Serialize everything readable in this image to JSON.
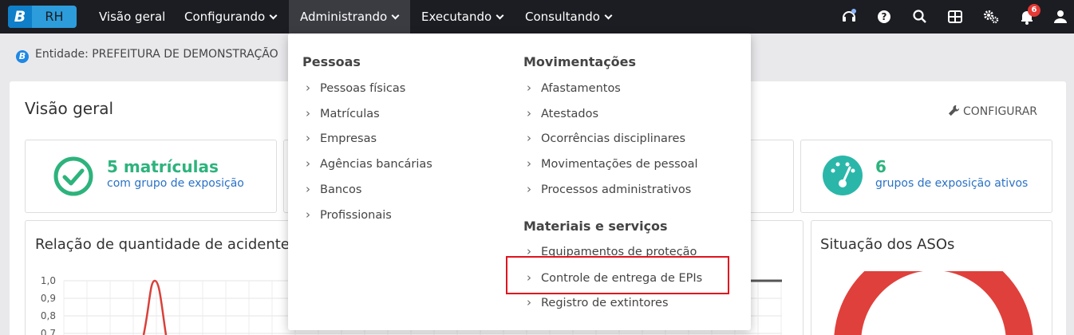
{
  "app": {
    "logo_letter": "B",
    "logo_text": "RH"
  },
  "nav": {
    "items": [
      {
        "label": "Visão geral"
      },
      {
        "label": "Configurando"
      },
      {
        "label": "Administrando"
      },
      {
        "label": "Executando"
      },
      {
        "label": "Consultando"
      }
    ],
    "notification_count": "6"
  },
  "entity": {
    "label": "Entidade: PREFEITURA DE DEMONSTRAÇÃO"
  },
  "page": {
    "title": "Visão geral",
    "config_label": "CONFIGURAR"
  },
  "cards": [
    {
      "value": "5 matrículas",
      "subtitle": "com grupo de exposição"
    },
    {
      "value": "6",
      "subtitle": "grupos de exposição ativos"
    }
  ],
  "charts": {
    "accidents_title": "Relação de quantidade de acidente",
    "aso_title": "Situação dos ASOs"
  },
  "chart_data": {
    "type": "line",
    "title": "Relação de quantidade de acidente",
    "y_ticks": [
      "1,0",
      "0,9",
      "0,8",
      "0,7"
    ],
    "ylim": [
      0.7,
      1.0
    ],
    "peak_value": 1.0,
    "grid": true
  },
  "dropdown": {
    "pessoas": {
      "title": "Pessoas",
      "items": [
        "Pessoas físicas",
        "Matrículas",
        "Empresas",
        "Agências bancárias",
        "Bancos",
        "Profissionais"
      ]
    },
    "movimentacoes": {
      "title": "Movimentações",
      "items": [
        "Afastamentos",
        "Atestados",
        "Ocorrências disciplinares",
        "Movimentações de pessoal",
        "Processos administrativos"
      ]
    },
    "materiais": {
      "title": "Materiais e serviços",
      "items": [
        "Equipamentos de proteção",
        "Controle de entrega de EPIs",
        "Registro de extintores"
      ]
    }
  },
  "colors": {
    "accent_green": "#2db37c",
    "link_blue": "#2a72c5",
    "highlight_red": "#e0141e",
    "nav_bg": "#1c1d22"
  }
}
